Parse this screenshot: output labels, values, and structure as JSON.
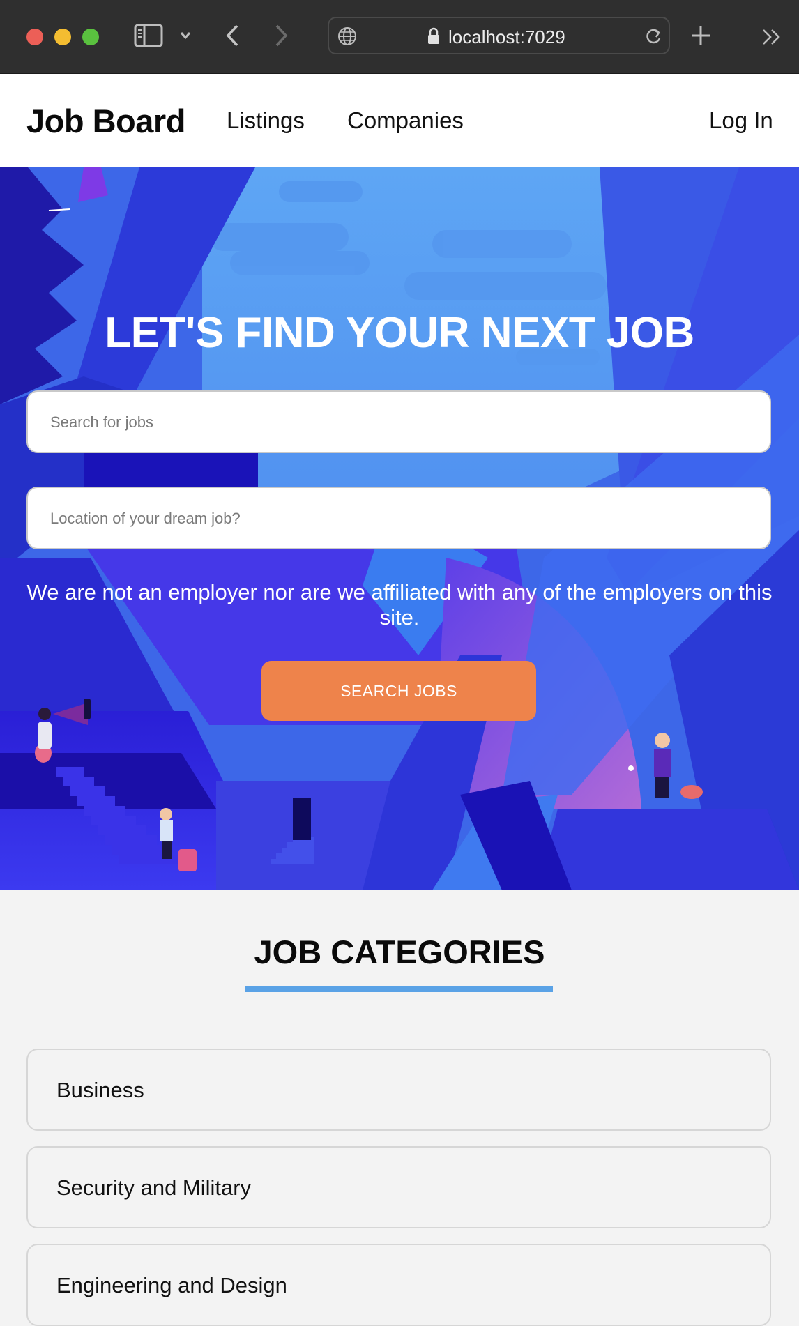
{
  "browser": {
    "url": "localhost:7029",
    "icons": [
      "sidebar-icon",
      "chevron-down-icon",
      "back-icon",
      "forward-icon",
      "globe-icon",
      "lock-icon",
      "reload-icon",
      "new-tab-icon",
      "overflow-icon"
    ]
  },
  "nav": {
    "brand": "Job Board",
    "links": [
      "Listings",
      "Companies"
    ],
    "login": "Log In"
  },
  "hero": {
    "title": "LET'S FIND YOUR NEXT JOB",
    "search_placeholder": "Search for jobs",
    "location_placeholder": "Location of your dream job?",
    "disclaimer": "We are not an employer nor are we affiliated with any of the employers on this site.",
    "button": "SEARCH JOBS"
  },
  "categories": {
    "title": "JOB CATEGORIES",
    "items": [
      "Business",
      "Security and Military",
      "Engineering and Design"
    ]
  },
  "colors": {
    "accent_button": "#ee834b",
    "underline": "#5aa2e6",
    "hero_blue": "#3b5fe0"
  }
}
